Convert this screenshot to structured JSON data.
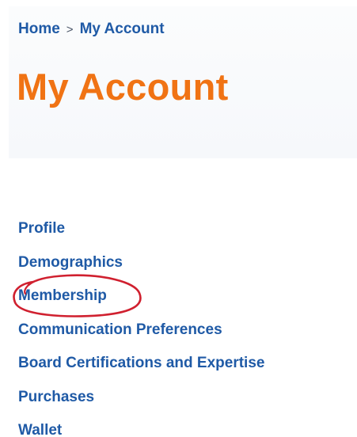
{
  "breadcrumb": {
    "home": "Home",
    "separator": ">",
    "current": "My Account"
  },
  "page": {
    "title": "My Account"
  },
  "nav": {
    "items": [
      {
        "label": "Profile"
      },
      {
        "label": "Demographics"
      },
      {
        "label": "Membership"
      },
      {
        "label": "Communication Preferences"
      },
      {
        "label": "Board Certifications and Expertise"
      },
      {
        "label": "Purchases"
      },
      {
        "label": "Wallet"
      }
    ]
  },
  "colors": {
    "link": "#1f5aa6",
    "title": "#f07314",
    "annotation": "#d0202f",
    "header_background": "#f6f8fb"
  }
}
